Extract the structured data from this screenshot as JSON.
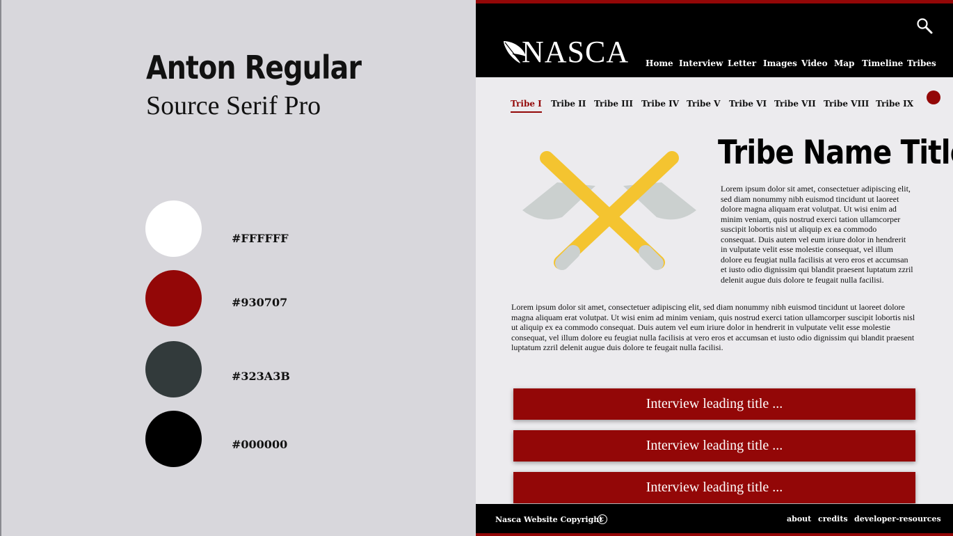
{
  "style_guide": {
    "heading_font": "Anton Regular",
    "body_font": "Source Serif Pro",
    "swatches": [
      {
        "hex": "#FFFFFF",
        "label": "#FFFFFF"
      },
      {
        "hex": "#930707",
        "label": "#930707"
      },
      {
        "hex": "#323A3B",
        "label": "#323A3B"
      },
      {
        "hex": "#000000",
        "label": "#000000"
      }
    ]
  },
  "site": {
    "logo": "NASCA",
    "nav": [
      "Home",
      "Interview",
      "Letter",
      "Images",
      "Video",
      "Map",
      "Timeline",
      "Tribes"
    ],
    "tabs": [
      "Tribe I",
      "Tribe II",
      "Tribe III",
      "Tribe IV",
      "Tribe V",
      "Tribe VI",
      "Tribe VII",
      "Tribe VIII",
      "Tribe IX"
    ],
    "active_tab": "Tribe I",
    "tribe_title": "Tribe Name Title",
    "paragraph_1": "Lorem ipsum dolor sit amet, consectetuer adipiscing elit, sed diam nonummy nibh euismod tincidunt ut laoreet dolore magna aliquam erat volutpat. Ut wisi enim ad minim veniam, quis nostrud exerci tation ullamcorper suscipit lobortis nisl ut aliquip ex ea commodo consequat. Duis autem vel eum iriure dolor in hendrerit in vulputate velit esse molestie consequat, vel illum dolore eu feugiat nulla facilisis at vero eros et accumsan et iusto odio dignissim qui blandit praesent luptatum zzril delenit augue duis dolore te feugait nulla facilisi.",
    "paragraph_2": "Lorem ipsum dolor sit amet, consectetuer adipiscing elit, sed diam nonummy nibh euismod tincidunt ut laoreet dolore magna aliquam erat volutpat. Ut wisi enim ad minim veniam, quis nostrud exerci tation ullamcorper suscipit lobortis nisl ut aliquip ex ea commodo consequat. Duis autem vel eum iriure dolor in hendrerit in vulputate velit esse molestie consequat, vel illum dolore eu feugiat nulla facilisis at vero eros et accumsan et iusto odio dignissim qui blandit praesent luptatum zzril delenit augue duis dolore te feugait nulla facilisi.",
    "interview_buttons": [
      "Interview leading title ...",
      "Interview leading title ...",
      "Interview leading title ..."
    ],
    "footer": {
      "copyright": "Nasca Website Copyright",
      "copyright_symbol": "c",
      "links": [
        "about",
        "credits",
        "developer-resources"
      ]
    },
    "icons": {
      "search": "search-icon",
      "logo_mark": "feather-icon",
      "illustration": "crossed-axes-icon"
    },
    "colors": {
      "accent": "#930707",
      "dark": "#323A3B",
      "black": "#000000",
      "white": "#FFFFFF",
      "axe_handle": "#F4C430",
      "axe_blade": "#CBD0CF"
    }
  }
}
